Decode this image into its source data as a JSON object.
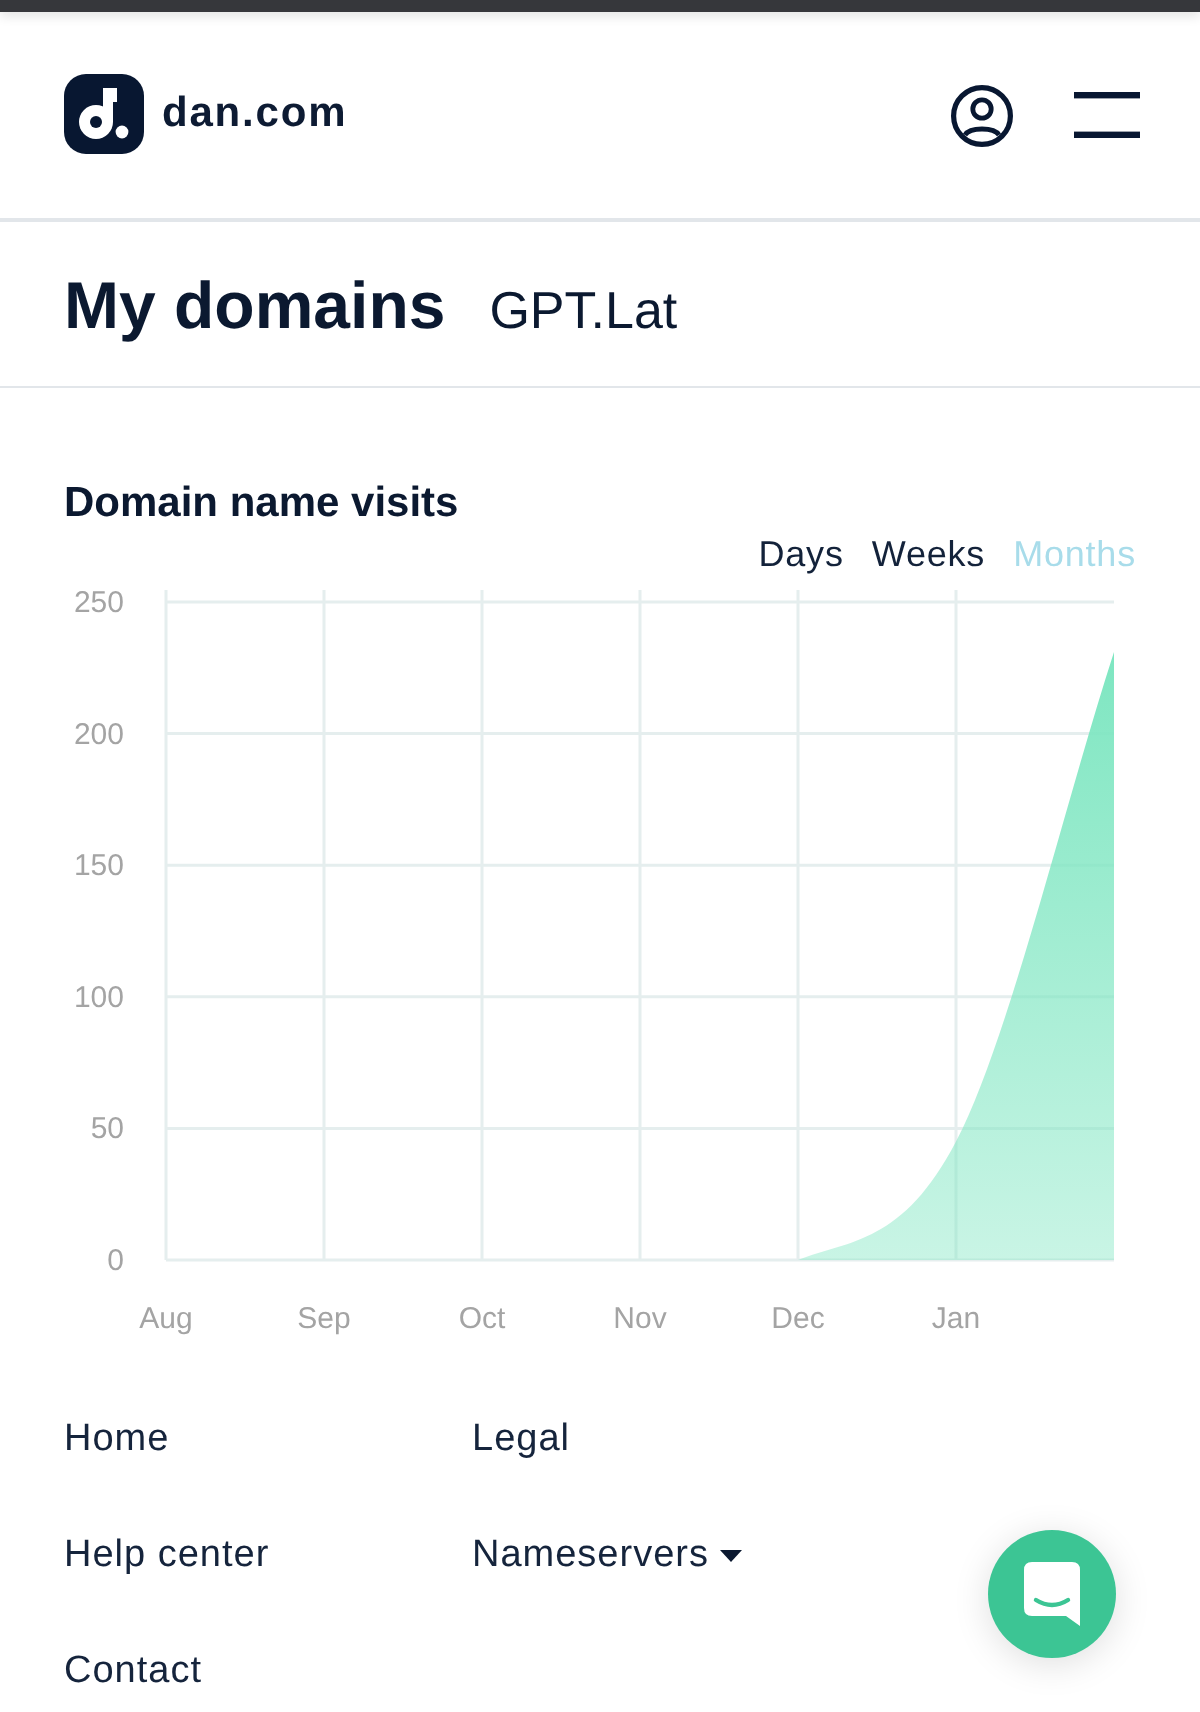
{
  "header": {
    "logo_text": "dan.com"
  },
  "page_title": {
    "heading": "My domains",
    "domain": "GPT.Lat"
  },
  "visits": {
    "title": "Domain name visits",
    "range_tabs": [
      {
        "label": "Days",
        "selected": false
      },
      {
        "label": "Weeks",
        "selected": false
      },
      {
        "label": "Months",
        "selected": true
      }
    ],
    "chart_data": {
      "type": "area",
      "categories": [
        "Aug",
        "Sep",
        "Oct",
        "Nov",
        "Dec",
        "Jan",
        null
      ],
      "series": [
        {
          "color": "#7ee6c1",
          "values": [
            0,
            0,
            0,
            0,
            0,
            45,
            231
          ]
        }
      ],
      "ylim": [
        0,
        250
      ],
      "yticks": [
        0,
        50,
        100,
        150,
        200,
        250
      ],
      "grid": true
    }
  },
  "footer": {
    "links": [
      {
        "label": "Home",
        "kind": "link"
      },
      {
        "label": "Legal",
        "kind": "link"
      },
      {
        "label": "Help center",
        "kind": "link"
      },
      {
        "label": "Nameservers",
        "kind": "dropdown"
      },
      {
        "label": "Contact",
        "kind": "link"
      }
    ]
  }
}
